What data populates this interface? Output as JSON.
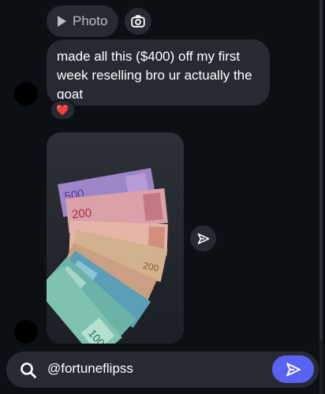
{
  "header": {
    "photo_pill": {
      "icon": "play-icon",
      "label": "Photo"
    },
    "camera_button": {
      "icon": "camera-icon"
    }
  },
  "message": {
    "text": "made all this ($400) off my first week reselling bro ur actually the goat",
    "reaction": "❤️"
  },
  "photo": {
    "description_icon": "photo-of-qatari-riyal-banknotes",
    "note_labels": [
      "500",
      "200",
      "200",
      "100"
    ]
  },
  "share_button": {
    "icon": "send-arrow-icon"
  },
  "composer": {
    "search_icon": "search-icon",
    "input_value": "@fortuneflipss",
    "send_icon": "send-icon"
  },
  "colors": {
    "background": "#0c0f14",
    "bubble": "#262b33",
    "accent": "#5a62f6"
  }
}
